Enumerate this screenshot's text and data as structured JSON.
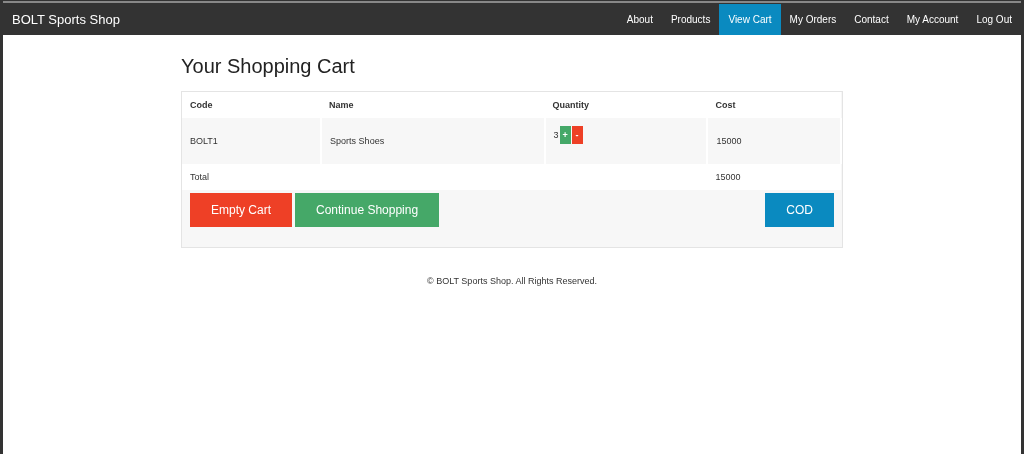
{
  "brand": "BOLT Sports Shop",
  "nav": [
    {
      "label": "About",
      "selected": false
    },
    {
      "label": "Products",
      "selected": false
    },
    {
      "label": "View Cart",
      "selected": true
    },
    {
      "label": "My Orders",
      "selected": false
    },
    {
      "label": "Contact",
      "selected": false
    },
    {
      "label": "My Account",
      "selected": false
    },
    {
      "label": "Log Out",
      "selected": false
    }
  ],
  "heading": "Your Shopping Cart",
  "table": {
    "columns": [
      "Code",
      "Name",
      "Quantity",
      "Cost"
    ],
    "rows": [
      {
        "code": "BOLT1",
        "name": "Sports Shoes",
        "quantity": "3",
        "increase": "+",
        "decrease": "-",
        "cost": "15000"
      }
    ],
    "total_label": "Total",
    "total": "15000"
  },
  "buttons": [
    {
      "label": "Empty Cart",
      "kind": "danger"
    },
    {
      "label": "Continue Shopping",
      "kind": "success"
    },
    {
      "label": "COD",
      "kind": "primary"
    }
  ],
  "footer": "© BOLT Sports Shop. All Rights Reserved."
}
